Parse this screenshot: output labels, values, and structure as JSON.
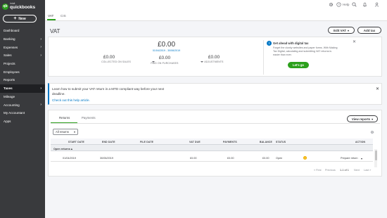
{
  "app": {
    "brand": "intuit",
    "name": "quickbooks",
    "new_label": "New"
  },
  "sidebar": {
    "items": [
      {
        "label": "Dashboard",
        "chevron": false,
        "active": false
      },
      {
        "label": "Banking",
        "chevron": true,
        "active": false
      },
      {
        "label": "Expenses",
        "chevron": true,
        "active": false
      },
      {
        "label": "Sales",
        "chevron": true,
        "active": false
      },
      {
        "label": "Projects",
        "chevron": false,
        "active": false
      },
      {
        "label": "Employees",
        "chevron": false,
        "active": false
      },
      {
        "label": "Reports",
        "chevron": false,
        "active": false
      },
      {
        "label": "Taxes",
        "chevron": true,
        "active": true
      },
      {
        "label": "Mileage",
        "chevron": false,
        "active": false
      },
      {
        "label": "Accounting",
        "chevron": true,
        "active": false
      },
      {
        "label": "My Accountant",
        "chevron": false,
        "active": false
      },
      {
        "label": "Apps",
        "chevron": false,
        "active": false
      }
    ]
  },
  "topbar": {
    "tabs": [
      "VAT",
      "CIS"
    ],
    "help_label": "Help",
    "icons": [
      "gear-icon",
      "help-icon",
      "search-icon",
      "bell-icon",
      "user-icon"
    ]
  },
  "header": {
    "title": "VAT",
    "edit_vat": "Edit VAT",
    "add_tax": "Add tax"
  },
  "summary": {
    "total": "£0.00",
    "period": "01/04/2019 - 30/06/2019",
    "collected_value": "£0.00",
    "collected_label": "COLLECTED ON SALES",
    "purchases_value": "£0.00",
    "purchases_label": "PAID ON PURCHASES",
    "adjustments_value": "£0.00",
    "adjustments_label": "ADJUSTMENTS"
  },
  "digital_tax": {
    "title": "Get ahead with digital tax",
    "text": "Forget the clunky websites and paper forms. With Making Tax Digital, calculating and submitting VAT returns is easier than ever.",
    "button": "Let's go"
  },
  "banner": {
    "text": "Learn how to submit your VAT return in a MTD compliant way before your next deadline.",
    "link": "Check out this help article."
  },
  "returns": {
    "tabs": [
      "Returns",
      "Payments"
    ],
    "view_reports": "View reports",
    "filter": "All returns",
    "columns": [
      "START DATE",
      "END DATE",
      "FILE DATE",
      "VAT DUE",
      "PAYMENTS",
      "BALANCE",
      "STATUS",
      "ACTION"
    ],
    "group": "Open returns",
    "rows": [
      {
        "start": "01/04/2019",
        "end": "30/06/2019",
        "file": "",
        "vat_due": "£0.00",
        "payments": "£0.00",
        "balance": "£0.00",
        "status": "Open",
        "action": "Prepare return"
      }
    ],
    "pager": {
      "first": "« First",
      "prev": "Previous",
      "range": "1-1 of 1",
      "next": "Next",
      "last": "Last »"
    }
  },
  "colors": {
    "accent": "#2ca01c",
    "sidebar": "#393a3d",
    "link": "#0077c5",
    "warning": "#f2b200"
  }
}
